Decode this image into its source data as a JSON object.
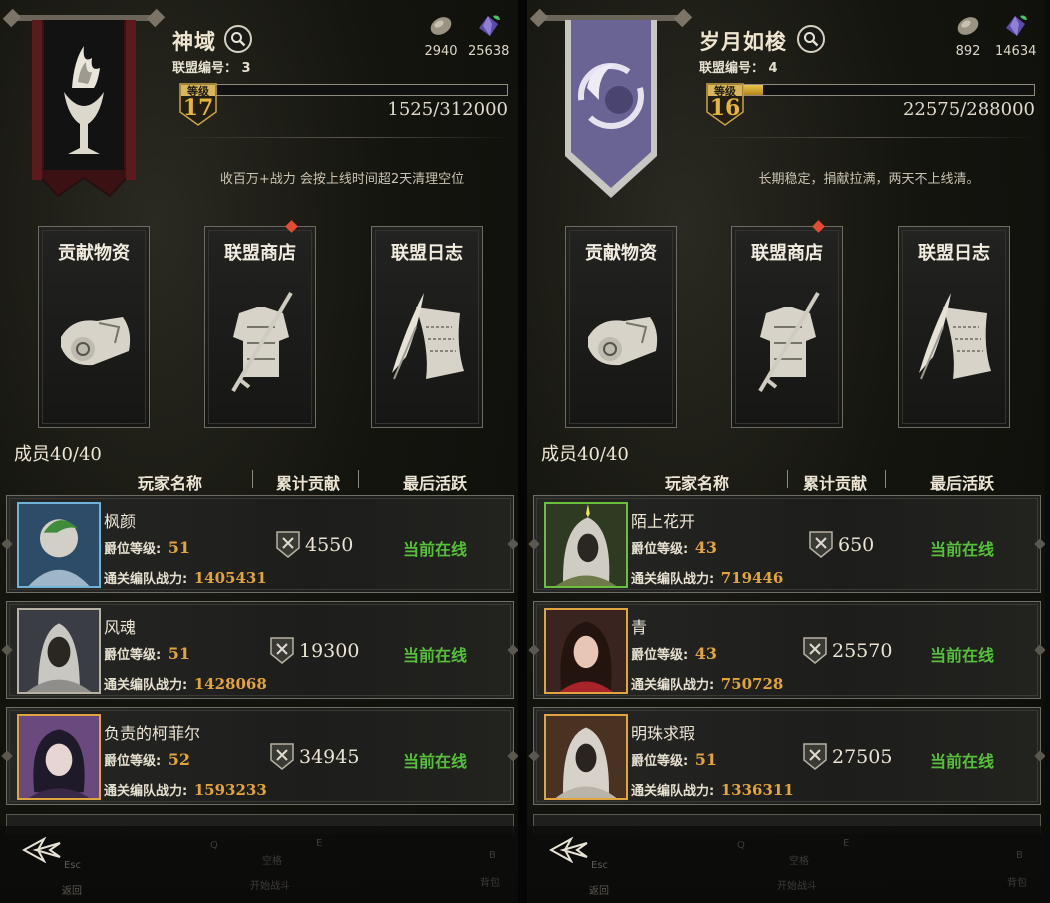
{
  "panels": [
    {
      "alliance_name": "神域",
      "alliance_id_label": "联盟编号：",
      "alliance_id": "3",
      "resource_1": "2940",
      "resource_2": "25638",
      "level_label": "等级",
      "level": "17",
      "xp_text": "1525/312000",
      "xp_fraction": 0.0049,
      "notice": "收百万+战力 会按上线时间超2天清理空位",
      "banner_color": "#5a1a1e",
      "cards": [
        {
          "title": "贡献物资",
          "badge": false
        },
        {
          "title": "联盟商店",
          "badge": true
        },
        {
          "title": "联盟日志",
          "badge": false
        }
      ],
      "members_label": "成员40/40",
      "columns": [
        "玩家名称",
        "累计贡献",
        "最后活跃"
      ],
      "members": [
        {
          "name": "枫颜",
          "rank_label": "爵位等级:",
          "rank": "51",
          "power_label": "通关编队战力:",
          "power": "1405431",
          "contribution": "4550",
          "status": "当前在线"
        },
        {
          "name": "风魂",
          "rank_label": "爵位等级:",
          "rank": "51",
          "power_label": "通关编队战力:",
          "power": "1428068",
          "contribution": "19300",
          "status": "当前在线"
        },
        {
          "name": "负责的柯菲尔",
          "rank_label": "爵位等级:",
          "rank": "52",
          "power_label": "通关编队战力:",
          "power": "1593233",
          "contribution": "34945",
          "status": "当前在线"
        }
      ],
      "bottom": {
        "esc": "Esc",
        "back": "返回",
        "q": "Q",
        "e": "E",
        "space": "空格",
        "start": "开始战斗",
        "b": "B",
        "bag": "背包"
      }
    },
    {
      "alliance_name": "岁月如梭",
      "alliance_id_label": "联盟编号：",
      "alliance_id": "4",
      "resource_1": "892",
      "resource_2": "14634",
      "level_label": "等级",
      "level": "16",
      "xp_text": "22575/288000",
      "xp_fraction": 0.078,
      "notice": "长期稳定，捐献拉满，两天不上线清。",
      "banner_color": "#6a6494",
      "cards": [
        {
          "title": "贡献物资",
          "badge": false
        },
        {
          "title": "联盟商店",
          "badge": true
        },
        {
          "title": "联盟日志",
          "badge": false
        }
      ],
      "members_label": "成员40/40",
      "columns": [
        "玩家名称",
        "累计贡献",
        "最后活跃"
      ],
      "members": [
        {
          "name": "陌上花开",
          "rank_label": "爵位等级:",
          "rank": "43",
          "power_label": "通关编队战力:",
          "power": "719446",
          "contribution": "650",
          "status": "当前在线"
        },
        {
          "name": "青",
          "rank_label": "爵位等级:",
          "rank": "43",
          "power_label": "通关编队战力:",
          "power": "750728",
          "contribution": "25570",
          "status": "当前在线"
        },
        {
          "name": "明珠求瑕",
          "rank_label": "爵位等级:",
          "rank": "51",
          "power_label": "通关编队战力:",
          "power": "1336311",
          "contribution": "27505",
          "status": "当前在线"
        }
      ],
      "bottom": {
        "esc": "Esc",
        "back": "返回",
        "q": "Q",
        "e": "E",
        "space": "空格",
        "start": "开始战斗",
        "b": "B",
        "bag": "背包"
      }
    }
  ],
  "icons": [
    "search-icon",
    "stone-resource-icon",
    "crystal-resource-icon",
    "level-badge-icon",
    "scroll-icon",
    "armor-icon",
    "quill-icon",
    "contribution-icon",
    "back-arrow-icon"
  ],
  "colors": {
    "online": "#57c03b",
    "value_gold": "#e2a43c",
    "xp_fill": "#d9a92e",
    "badge_red": "#e34b33"
  }
}
